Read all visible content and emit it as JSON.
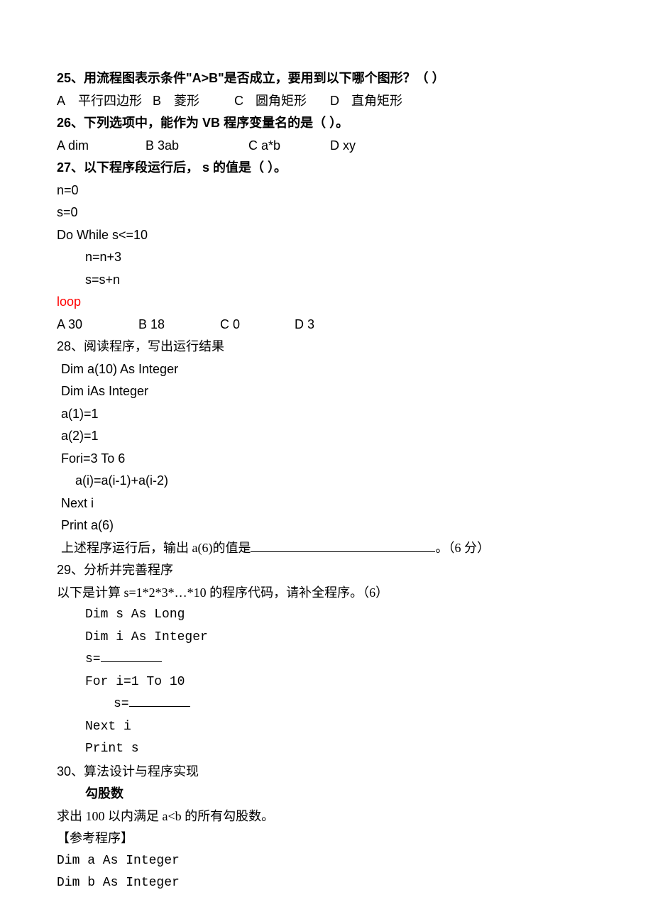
{
  "q25": {
    "prefix": "25、",
    "text_front": "用流程图表示条件\"",
    "emph": "A>B",
    "text_back": "\"是否成立，要用到以下哪个图形？（  ）",
    "optA_lbl": "A ",
    "optA": "平行四边形",
    "optB_lbl": "B ",
    "optB": "菱形",
    "optC_lbl": "C ",
    "optC": "圆角矩形",
    "optD_lbl": "D ",
    "optD": "直角矩形"
  },
  "q26": {
    "prefix": "26、",
    "text_front": "下列选项中，能作为 ",
    "emph": "VB",
    "text_back": " 程序变量名的是（  ）。",
    "optA": "A dim",
    "optB": "B 3ab",
    "optC": "C a*b",
    "optD": "D xy"
  },
  "q27": {
    "prefix": "27、",
    "text_front": "以下程序段运行后，",
    "emph": " s ",
    "text_back": "的值是（  ）。",
    "code1": "n=0",
    "code2": "s=0",
    "code3": "Do While  s<=10",
    "code4": "n=n+3",
    "code5": "s=s+n",
    "code6": "loop",
    "optA": "A 30",
    "optB": "B 18",
    "optC": "C 0",
    "optD": "D 3"
  },
  "q28": {
    "title": "28、阅读程序，写出运行结果",
    "c1": "Dim a(10)  As  Integer",
    "c2": "Dim iAs Integer",
    "c3": "a(1)=1",
    "c4": "a(2)=1",
    "c5": "Fori=3 To 6",
    "c6": "a(i)=a(i-1)+a(i-2)",
    "c7": "Next  i",
    "c8": "Print a(6)",
    "result_front": "上述程序运行后，输出 a(6)的值是",
    "result_back": "。（6 分）"
  },
  "q29": {
    "title": "29、分析并完善程序",
    "desc": "以下是计算 s=1*2*3*…*10 的程序代码，请补全程序。（6）",
    "c1": "Dim s As Long",
    "c2": "Dim i As Integer",
    "c3": "s=",
    "c4": "For i=1 To 10",
    "c5": "s=",
    "c6": "Next i",
    "c7": "Print s"
  },
  "q30": {
    "title": "30、算法设计与程序实现",
    "subtitle": "勾股数",
    "desc": "求出 100 以内满足 a<b 的所有勾股数。",
    "ref": "【参考程序】",
    "c1": "Dim a As Integer",
    "c2": "Dim b As Integer"
  }
}
